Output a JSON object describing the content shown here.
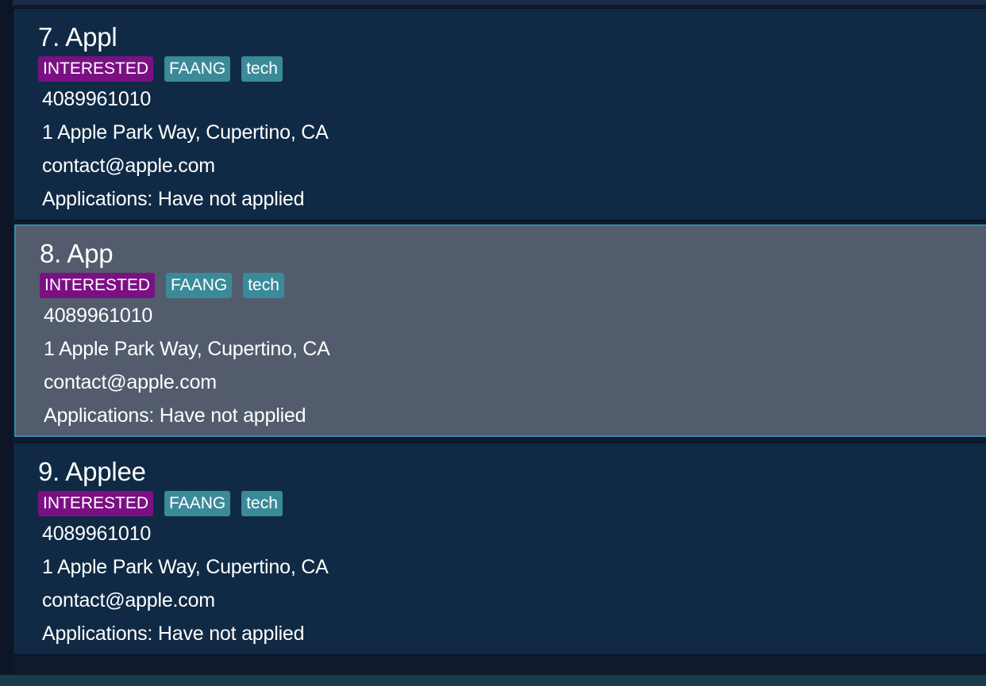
{
  "cards": [
    {
      "index": "7.",
      "name": "Appl",
      "status_tag": "INTERESTED",
      "tags": [
        "FAANG",
        "tech"
      ],
      "phone": "4089961010",
      "address": "1 Apple Park Way, Cupertino, CA",
      "email": "contact@apple.com",
      "applications": "Applications: Have not applied",
      "selected": false
    },
    {
      "index": "8.",
      "name": "App",
      "status_tag": "INTERESTED",
      "tags": [
        "FAANG",
        "tech"
      ],
      "phone": "4089961010",
      "address": "1 Apple Park Way, Cupertino, CA",
      "email": "contact@apple.com",
      "applications": "Applications: Have not applied",
      "selected": true
    },
    {
      "index": "9.",
      "name": "Applee",
      "status_tag": "INTERESTED",
      "tags": [
        "FAANG",
        "tech"
      ],
      "phone": "4089961010",
      "address": "1 Apple Park Way, Cupertino, CA",
      "email": "contact@apple.com",
      "applications": "Applications: Have not applied",
      "selected": false
    }
  ],
  "colors": {
    "card_background": "#102a45",
    "selected_background": "#525c6d",
    "selected_border": "#2f8ea6",
    "status_tag": "#7b1085",
    "tag": "#3b8a9a",
    "text": "#ffffff"
  }
}
